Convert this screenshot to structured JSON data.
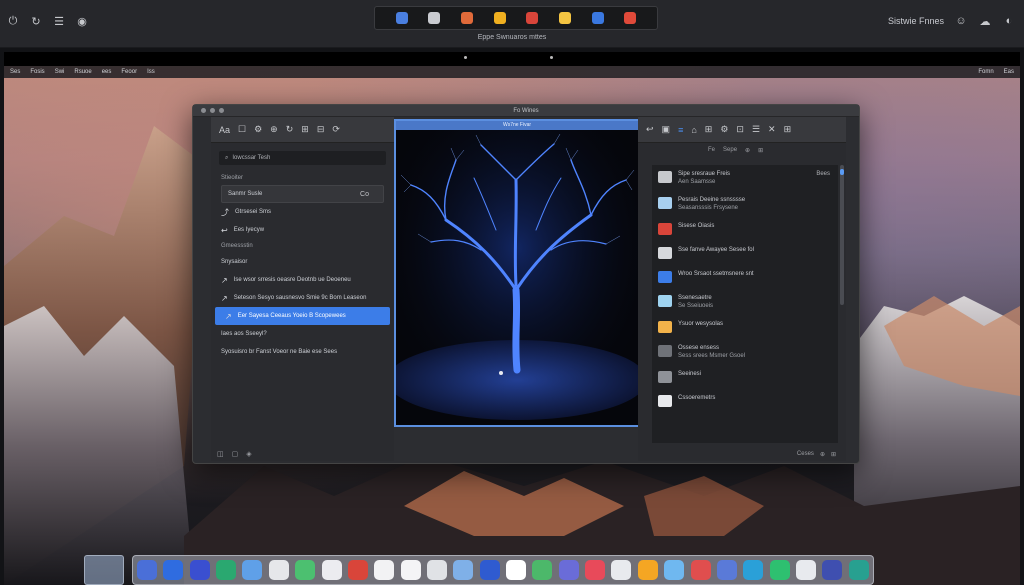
{
  "outer": {
    "left_icons": [
      "power-icon",
      "refresh-icon",
      "list-icon",
      "camera-icon"
    ],
    "center_icons": [
      {
        "name": "monitor-icon",
        "color": "#4a7fe0"
      },
      {
        "name": "frame-icon",
        "color": "#c9cbd0"
      },
      {
        "name": "fire-icon",
        "color": "#e06a3a"
      },
      {
        "name": "palette-icon",
        "color": "#f0b020"
      },
      {
        "name": "bag-icon",
        "color": "#d9453a"
      },
      {
        "name": "paint-icon",
        "color": "#f5c542"
      },
      {
        "name": "shield-icon",
        "color": "#3a78e0"
      },
      {
        "name": "pin-icon",
        "color": "#e04a3a"
      }
    ],
    "right_label": "Sistwie Fnnes",
    "right_icons": [
      "user-icon",
      "cloud-icon",
      "apple-icon"
    ],
    "caption": "Eppe Swnuaros mttes"
  },
  "menubar": {
    "items": [
      "Ses",
      "Fosis",
      "Swi",
      "Rsuoe",
      "ees",
      "Feoor",
      "Iss"
    ],
    "right_items": [
      "Fomn",
      "Eas"
    ]
  },
  "app": {
    "title": "Fo Wines",
    "left": {
      "toolbar": [
        "Aa",
        "☐",
        "⚙",
        "⊕",
        "↻",
        "⊞",
        "⊟",
        "⟳"
      ],
      "search": "Iowcssar Tesh",
      "rows": [
        {
          "text": "Stieoiter",
          "type": "header"
        },
        {
          "text": "Sanmr Susle",
          "type": "boxed",
          "right": "Co"
        },
        {
          "text": "Gtrsesei Sms",
          "type": "plain",
          "pin": "⤴"
        },
        {
          "text": "Ees Iyecyw",
          "type": "plain",
          "pin": "↩"
        },
        {
          "text": "Gmeessstin",
          "type": "header"
        },
        {
          "text": "Snysaisor",
          "type": "plain"
        },
        {
          "text": "Ise wsor srresis oeasre Deotnb ue Deoeneu",
          "type": "plain",
          "pin": "↗"
        },
        {
          "text": "Seteson Sesyo sausnesvo Smie 9c Bom Leaseon",
          "type": "plain",
          "pin": "↗"
        },
        {
          "text": "Eer Sayesa Ceeaus Yoeio B Scopewees",
          "type": "selected",
          "pin": "↗"
        },
        {
          "text": "Iaes aos Sseeyl?",
          "type": "plain"
        },
        {
          "text": "Syosuisro br Fanst Voeor ne Baie ese Sees",
          "type": "plain"
        }
      ],
      "footer": [
        "◫",
        "▢",
        "◈"
      ]
    },
    "center": {
      "title": "Ws7ne Fivar"
    },
    "right": {
      "toolbar": [
        "↩",
        "▣",
        "≡",
        "⌂",
        "⊞",
        "⚙",
        "⊡",
        "☰",
        "✕",
        "⊞"
      ],
      "subbar": [
        "Fe",
        "Sepe",
        "⊕",
        "⊞"
      ],
      "items": [
        {
          "title": "Sipe sresraue Freis",
          "sub": "Aen Saamsse",
          "thumb": "#c7c9cd",
          "badge": "Bees"
        },
        {
          "title": "Pesrais Deeine ssnsssse",
          "sub": "Seasansssis Frsysene",
          "thumb": "#a8d0f0"
        },
        {
          "title": "Sisese Oiasis",
          "sub": "",
          "thumb": "#d9453a"
        },
        {
          "title": "Sse fanve Awayee Sesee fol",
          "sub": "",
          "thumb": "#d6d8dc"
        },
        {
          "title": "Wroo Srsaot ssetmsnere snt",
          "sub": "",
          "thumb": "#3c7de8"
        },
        {
          "title": "Ssenesaetre",
          "sub": "Se Sseiuoeis",
          "thumb": "#9fd3f0"
        },
        {
          "title": "Ysuor wesysolas",
          "sub": "",
          "thumb": "#f2b24a"
        },
        {
          "title": "Ossese ensess",
          "sub": "Sess srees Msmer Gsoel",
          "thumb": "#6f7278"
        },
        {
          "title": "Seeinesi",
          "sub": "",
          "thumb": "#8f9298"
        },
        {
          "title": "Cssoeremetrs",
          "sub": "",
          "thumb": "#e8e9ec"
        }
      ],
      "footer": [
        "Ceses",
        "⊕",
        "⊞"
      ]
    }
  },
  "dock": {
    "items": [
      "#4a6fd8",
      "#2f6ce0",
      "#3a4fd0",
      "#2aa870",
      "#5fa0e8",
      "#e6e7ea",
      "#4cc070",
      "#ececf0",
      "#d9453a",
      "#f2f2f4",
      "#f4f4f6",
      "#e0e2e6",
      "#7fb0e8",
      "#2f5bd0",
      "#ffffff",
      "#4cb86a",
      "#6a6cd8",
      "#e84a5a",
      "#e8eaee",
      "#f5a623",
      "#6fb8f0",
      "#e04e4e",
      "#5a7ad8",
      "#2aa0d8",
      "#2ec070",
      "#e8eaee",
      "#3f4fb0",
      "#28a090"
    ]
  }
}
